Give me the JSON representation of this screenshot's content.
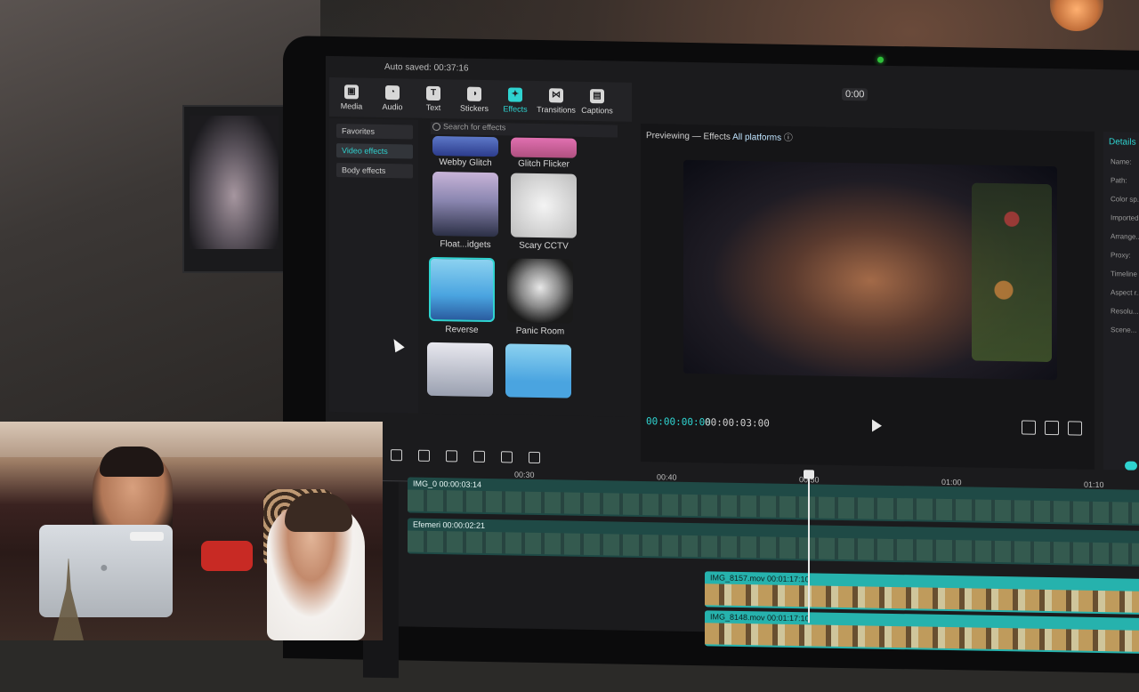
{
  "app": {
    "autosave": "Auto saved: 00:37:16",
    "window_badge": "0:00"
  },
  "toolbar": [
    {
      "label": "Media",
      "icon": "media-icon"
    },
    {
      "label": "Audio",
      "icon": "audio-icon"
    },
    {
      "label": "Text",
      "icon": "text-icon"
    },
    {
      "label": "Stickers",
      "icon": "stickers-icon"
    },
    {
      "label": "Effects",
      "icon": "effects-icon",
      "active": true
    },
    {
      "label": "Transitions",
      "icon": "transitions-icon"
    },
    {
      "label": "Captions",
      "icon": "captions-icon"
    }
  ],
  "sidebar": {
    "items": [
      {
        "label": "Favorites"
      },
      {
        "label": "Video effects",
        "active": true
      },
      {
        "label": "Body effects"
      }
    ]
  },
  "effects": {
    "search_placeholder": "Search for effects",
    "items": [
      {
        "label": "Webby Glitch"
      },
      {
        "label": "Glitch Flicker"
      },
      {
        "label": "Float...idgets"
      },
      {
        "label": "Scary CCTV"
      },
      {
        "label": "Reverse"
      },
      {
        "label": "Panic Room"
      },
      {
        "label": ""
      },
      {
        "label": ""
      }
    ]
  },
  "preview": {
    "header_prefix": "Previewing — Effects",
    "platform": "All platforms",
    "current_time": "00:00:00:00",
    "total_time": "00:00:03:00"
  },
  "details": {
    "tab": "Details",
    "rows": [
      "Name:",
      "Path:",
      "Color sp...",
      "Imported",
      "Arrange...",
      "Proxy:",
      "Timeline",
      "Aspect r...",
      "Resolu...",
      "Scene..."
    ]
  },
  "timeline": {
    "ruler": [
      "00:30",
      "00:40",
      "00:50",
      "01:00",
      "01:10"
    ],
    "tracks": [
      {
        "label": "IMG_0 00:00:03:14",
        "style": "dark"
      },
      {
        "label": "Efemeri 00:00:02:21",
        "style": "dark"
      },
      {
        "label": "IMG_8157.mov 00:01:17:10",
        "style": "bright"
      },
      {
        "label": "IMG_8148.mov 00:01:17:10",
        "style": "bright"
      }
    ]
  }
}
